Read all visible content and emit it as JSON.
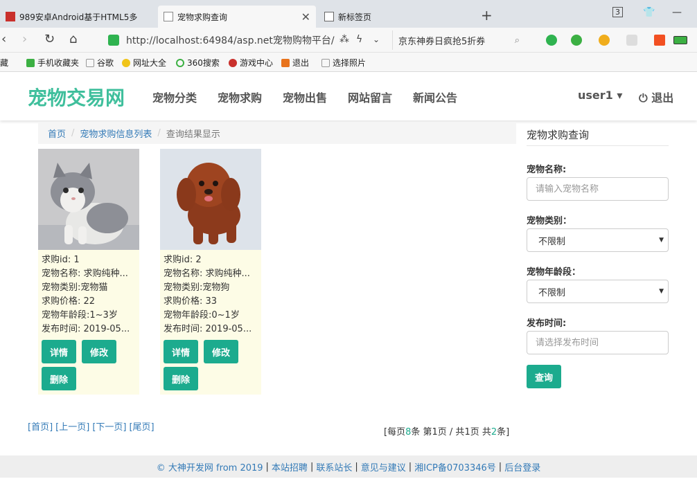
{
  "browser": {
    "tabs": [
      {
        "title": "989安卓Android基于HTML5多"
      },
      {
        "title": "宠物求购查询"
      },
      {
        "title": "新标签页"
      }
    ],
    "new_tab": "+",
    "tab_count": "3",
    "url": "http://localhost:64984/asp.net宠物购物平台/",
    "search_text": "京东神券日疯抢5折券",
    "bookmarks": [
      "藏",
      "手机收藏夹",
      "谷歌",
      "网址大全",
      "360搜索",
      "游戏中心",
      "退出",
      "选择照片"
    ]
  },
  "navbar": {
    "brand": "宠物交易网",
    "links": [
      "宠物分类",
      "宠物求购",
      "宠物出售",
      "网站留言",
      "新闻公告"
    ],
    "user": "user1 ▾",
    "logout": "退出"
  },
  "breadcrumb": {
    "home": "首页",
    "list": "宠物求购信息列表",
    "current": "查询结果显示",
    "sep": "/"
  },
  "cards": [
    {
      "id_line": "求购id: 1",
      "name_line": "宠物名称: 求购纯种...",
      "type_line": "宠物类别:宠物猫",
      "price_line": "求购价格: 22",
      "age_line": "宠物年龄段:1~3岁",
      "time_line": "发布时间: 2019-05...",
      "detail": "详情",
      "edit": "修改",
      "del": "删除"
    },
    {
      "id_line": "求购id: 2",
      "name_line": "宠物名称: 求购纯种...",
      "type_line": "宠物类别:宠物狗",
      "price_line": "求购价格: 33",
      "age_line": "宠物年龄段:0~1岁",
      "time_line": "发布时间: 2019-05...",
      "detail": "详情",
      "edit": "修改",
      "del": "删除"
    }
  ],
  "pager": {
    "first": "[首页]",
    "prev": "[上一页]",
    "next": "[下一页]",
    "last": "[尾页]",
    "info_pre": "[每页",
    "per_page": "8",
    "info_mid": "条 第",
    "page": "1",
    "info_mid2": "页 / 共",
    "total_pages": "1",
    "info_mid3": "页 共",
    "total": "2",
    "info_post": "条]"
  },
  "sidebar": {
    "title": "宠物求购查询",
    "name_label": "宠物名称:",
    "name_placeholder": "请输入宠物名称",
    "type_label": "宠物类别：",
    "type_value": "不限制",
    "age_label": "宠物年龄段：",
    "age_value": "不限制",
    "time_label": "发布时间:",
    "time_placeholder": "请选择发布时间",
    "submit": "查询"
  },
  "footer": {
    "copyright": "© 大神开发网 from 2019",
    "links": [
      "本站招聘",
      "联系站长",
      "意见与建议",
      "湘ICP备0703346号",
      "后台登录"
    ],
    "sep": "|"
  },
  "colors": {
    "brand": "#3fbf9c",
    "button": "#1cab8e",
    "link": "#337ab7",
    "card_bg": "#fdfce6"
  }
}
